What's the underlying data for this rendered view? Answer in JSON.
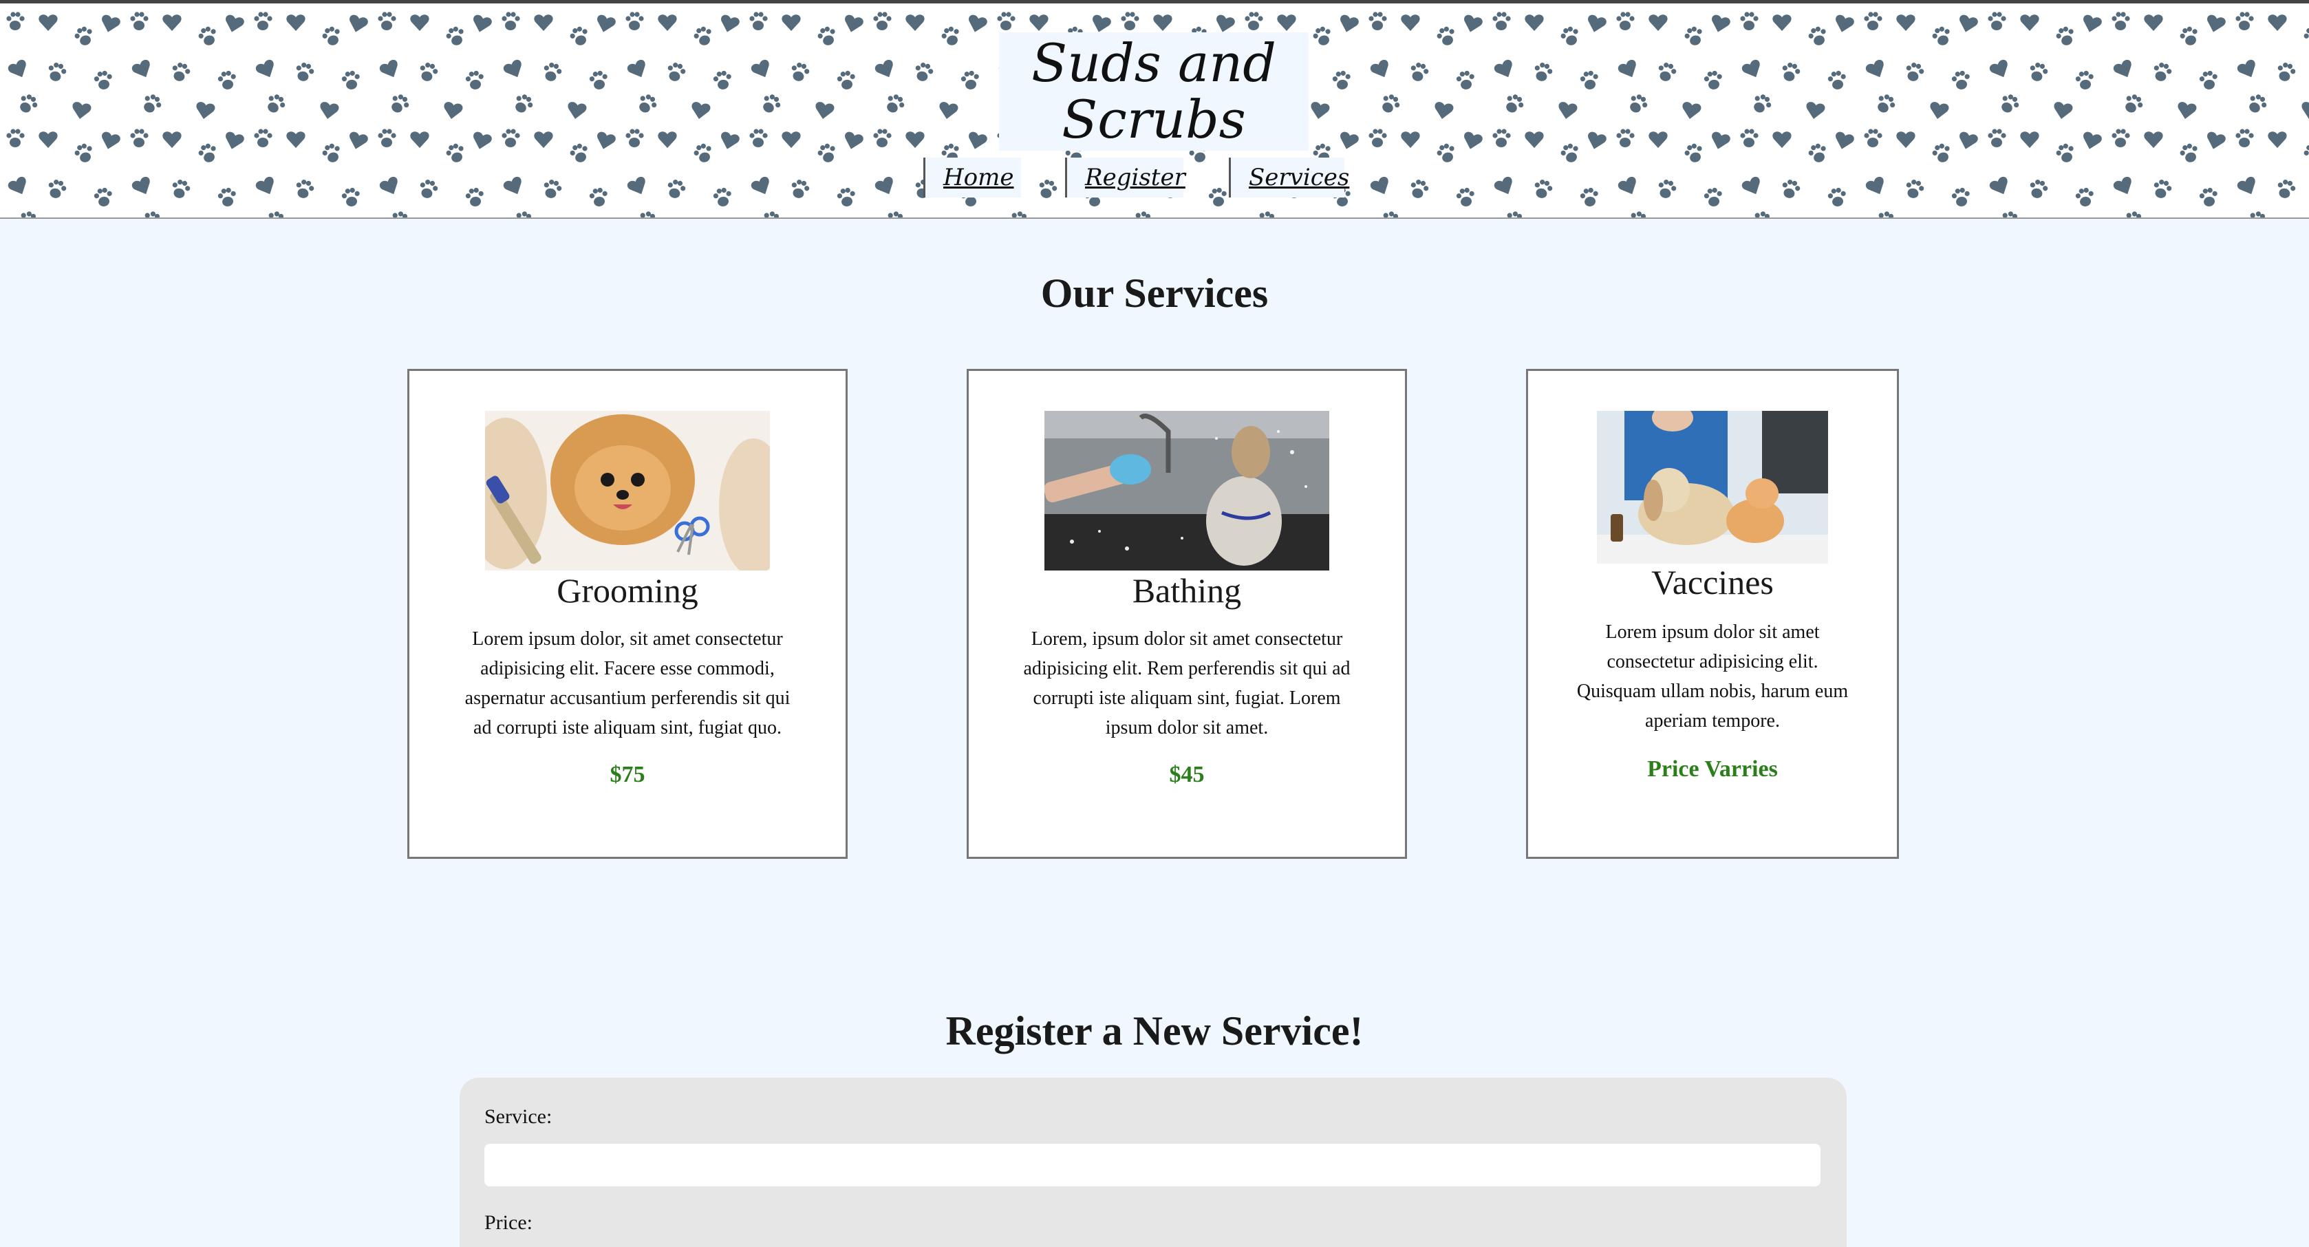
{
  "header": {
    "logo_text": "Suds and Scrubs",
    "nav": [
      {
        "label": "Home"
      },
      {
        "label": "Register"
      },
      {
        "label": "Services"
      }
    ]
  },
  "services": {
    "title": "Our Services",
    "cards": [
      {
        "title": "Grooming",
        "description": "Lorem ipsum dolor, sit amet consectetur adipisicing elit. Facere esse commodi, aspernatur accusantium perferendis sit qui ad corrupti iste aliquam sint, fugiat quo.",
        "price": "$75"
      },
      {
        "title": "Bathing",
        "description": "Lorem, ipsum dolor sit amet consectetur adipisicing elit. Rem perferendis sit qui ad corrupti iste aliquam sint, fugiat. Lorem ipsum dolor sit amet.",
        "price": "$45"
      },
      {
        "title": "Vaccines",
        "description": "Lorem ipsum dolor sit amet consectetur adipisicing elit. Quisquam ullam nobis, harum eum aperiam tempore.",
        "price": "Price Varries"
      }
    ]
  },
  "register": {
    "title": "Register a New Service!",
    "service_label": "Service:",
    "service_value": "",
    "price_label": "Price:"
  },
  "colors": {
    "page_bg": "#f0f7ff",
    "paw_pattern": "#556a7a",
    "price_green": "#2a7f1a",
    "form_bg": "#e6e6e6"
  }
}
